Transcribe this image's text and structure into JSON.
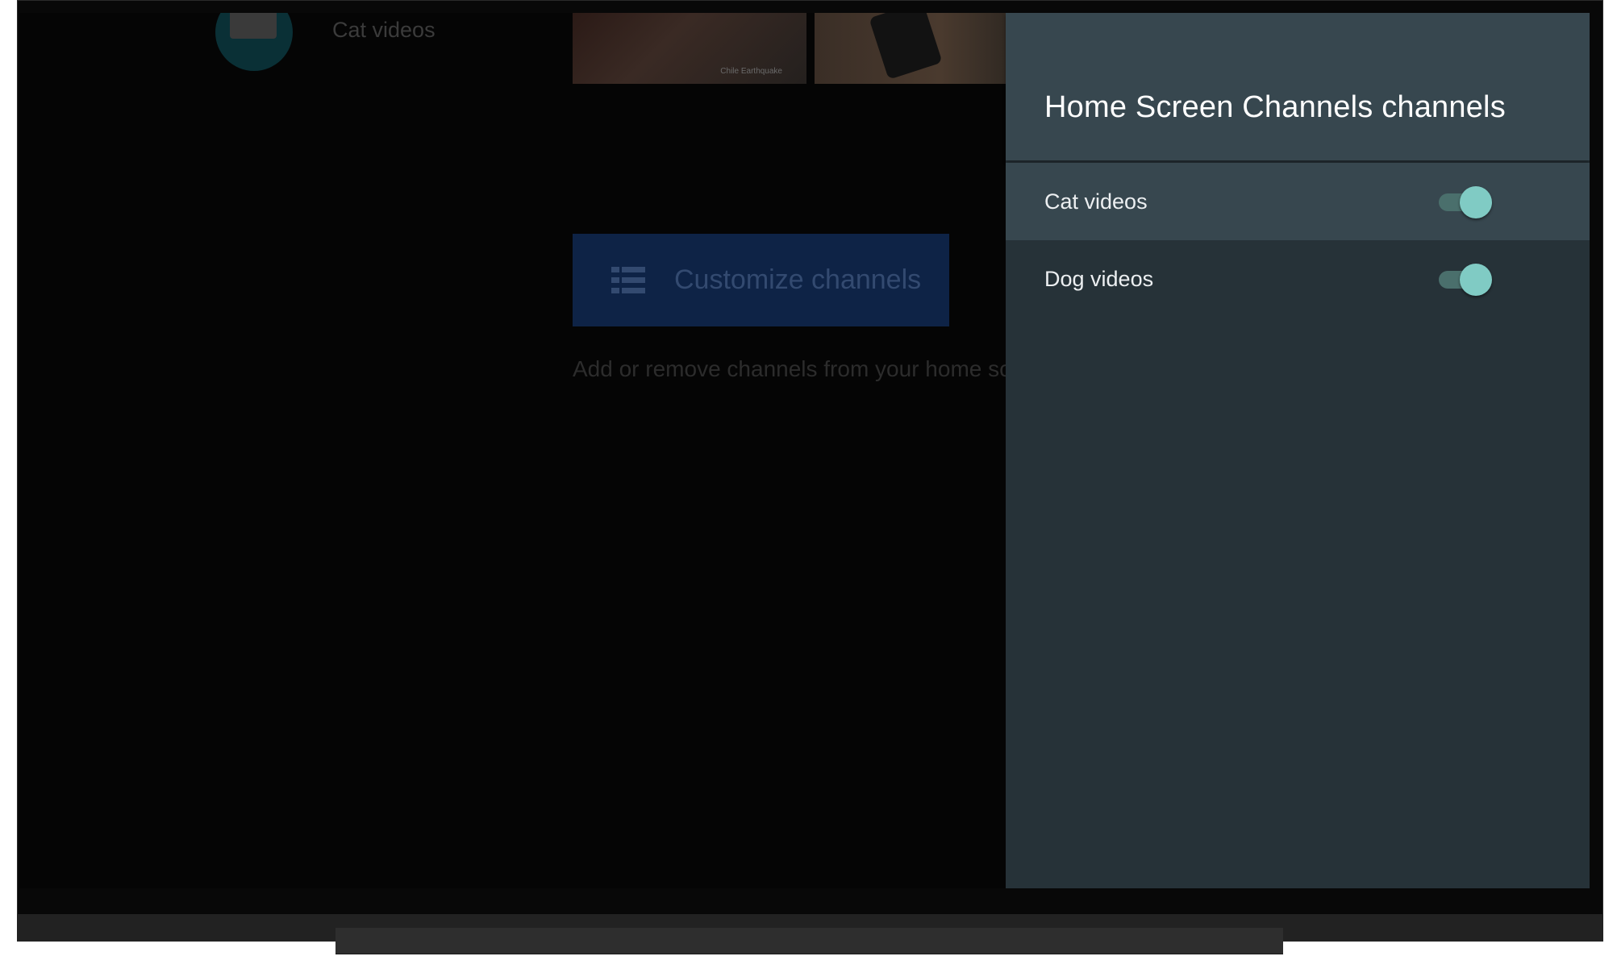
{
  "background": {
    "channel_title": "Cat videos",
    "thumbnail_caption": "Chile Earthquake",
    "customize_button_label": "Customize channels",
    "customize_description": "Add or remove channels from your home sc"
  },
  "panel": {
    "title": "Home Screen Channels channels",
    "items": [
      {
        "label": "Cat videos",
        "enabled": true
      },
      {
        "label": "Dog videos",
        "enabled": true
      }
    ]
  },
  "colors": {
    "panel_bg": "#263238",
    "panel_header_bg": "#37474f",
    "switch_on": "#80cbc4",
    "customize_button_bg": "#0e2346"
  }
}
